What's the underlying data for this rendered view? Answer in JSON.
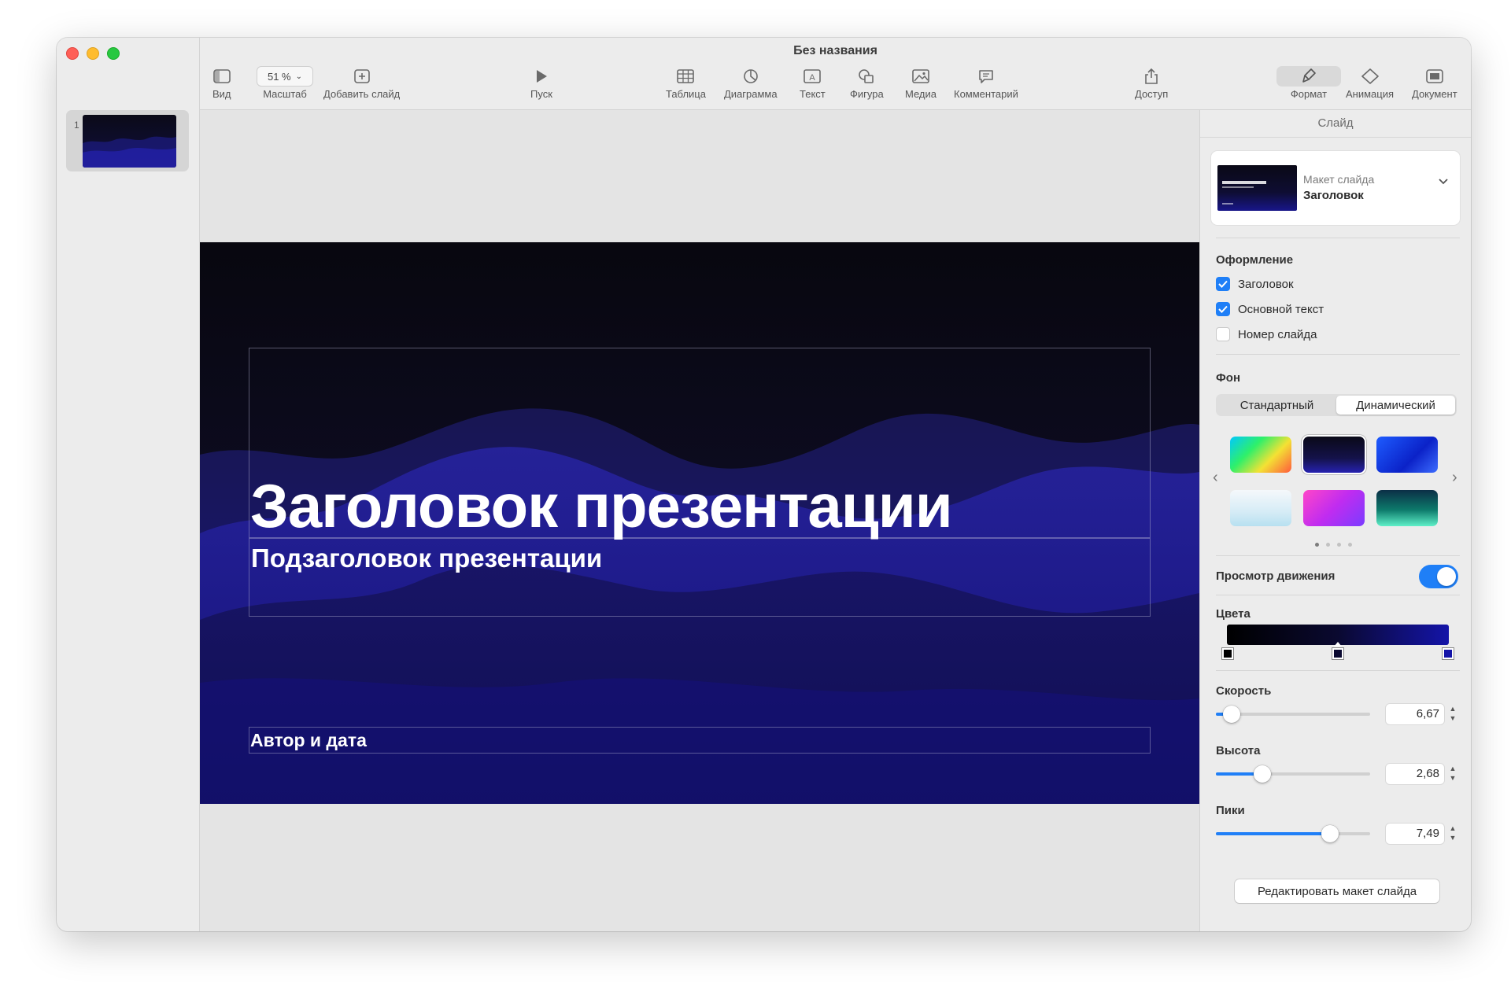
{
  "window": {
    "title": "Без названия"
  },
  "toolbar": {
    "view": "Вид",
    "zoom_value": "51 %",
    "zoom_label": "Масштаб",
    "add_slide": "Добавить слайд",
    "play": "Пуск",
    "table": "Таблица",
    "chart": "Диаграмма",
    "text": "Текст",
    "shape": "Фигура",
    "media": "Медиа",
    "comment": "Комментарий",
    "share": "Доступ",
    "format": "Формат",
    "animate": "Анимация",
    "document": "Документ"
  },
  "navigator": {
    "slide_number": "1"
  },
  "slide": {
    "title": "Заголовок презентации",
    "subtitle": "Подзаголовок презентации",
    "author": "Автор и дата"
  },
  "inspector": {
    "tab": "Слайд",
    "layout": {
      "caption": "Макет слайда",
      "name": "Заголовок"
    },
    "appearance": {
      "heading": "Оформление",
      "title_label": "Заголовок",
      "title_checked": true,
      "body_label": "Основной текст",
      "body_checked": true,
      "number_label": "Номер слайда",
      "number_checked": false
    },
    "background": {
      "heading": "Фон",
      "standard": "Стандартный",
      "dynamic": "Динамический",
      "selected": "Динамический",
      "page": 1,
      "pages": 4
    },
    "motion_preview": {
      "label": "Просмотр движения",
      "on": true
    },
    "colors": {
      "heading": "Цвета",
      "stops": [
        "#000000",
        "#0a0930",
        "#1414a8"
      ]
    },
    "speed": {
      "label": "Скорость",
      "value": "6,67",
      "level": 0.1
    },
    "height": {
      "label": "Высота",
      "value": "2,68",
      "level": 0.3
    },
    "peaks": {
      "label": "Пики",
      "value": "7,49",
      "level": 0.74
    },
    "edit_layout": "Редактировать макет слайда"
  }
}
